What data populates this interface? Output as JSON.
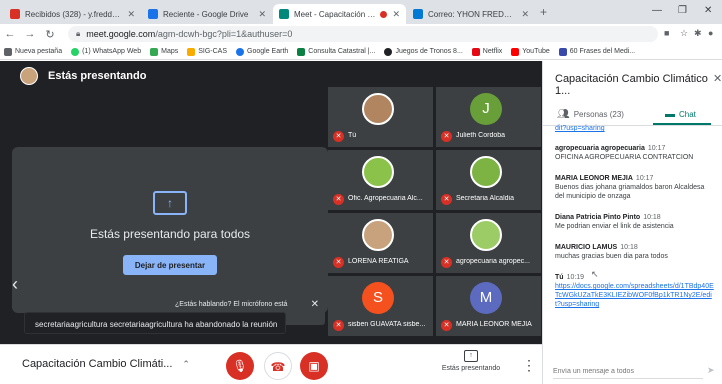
{
  "browser": {
    "tabs": [
      {
        "title": "Recibidos (328) - y.freddymcj@g",
        "color": "#d93025",
        "active": false
      },
      {
        "title": "Reciente - Google Drive",
        "color": "#1a73e8",
        "active": false
      },
      {
        "title": "Meet - Capacitación Cambio",
        "color": "#00897b",
        "active": true
      },
      {
        "title": "Correo: YHON FREDDY MURILLO",
        "color": "#0078d4",
        "active": false
      }
    ],
    "new_tab": "+",
    "address": {
      "host": "meet.google.com",
      "path": "/agm-dcwh-bgc?pli=1&authuser=0"
    },
    "bookmarks": [
      {
        "label": "Nueva pestaña",
        "color": "#5f6368"
      },
      {
        "label": "(1) WhatsApp Web",
        "color": "#25d366"
      },
      {
        "label": "Maps",
        "color": "#34a853"
      },
      {
        "label": "SIG-CAS",
        "color": "#f9ab00"
      },
      {
        "label": "Google Earth",
        "color": "#1a73e8"
      },
      {
        "label": "Consulta Catastral |...",
        "color": "#0b8043"
      },
      {
        "label": "Juegos de Tronos 8...",
        "color": "#202124"
      },
      {
        "label": "Netflix",
        "color": "#e50914"
      },
      {
        "label": "YouTube",
        "color": "#ff0000"
      },
      {
        "label": "60 Frases del Medi...",
        "color": "#3949ab"
      }
    ]
  },
  "meet": {
    "presenting_header": "Estás presentando",
    "card": {
      "message": "Estás presentando para todos",
      "stop_button": "Dejar de presentar"
    },
    "tiles": [
      {
        "name": "Tú",
        "initial": "",
        "color": "#b0855f",
        "pic": true
      },
      {
        "name": "Julieth Cordoba",
        "initial": "J",
        "color": "#689f38",
        "pic": false
      },
      {
        "name": "Ofic. Agropecuaria Alc...",
        "initial": "",
        "color": "#8bc34a",
        "pic": true
      },
      {
        "name": "Secretaria Alcaldia",
        "initial": "",
        "color": "#7cb342",
        "pic": true
      },
      {
        "name": "LORENA REATIGA",
        "initial": "",
        "color": "#c8a27c",
        "pic": true
      },
      {
        "name": "agropecuaria agropec...",
        "initial": "",
        "color": "#9ccc65",
        "pic": true
      },
      {
        "name": "sisben GUAVATA sisbe...",
        "initial": "S",
        "color": "#f4511e",
        "pic": false
      },
      {
        "name": "MARIA LEONOR MEJIA",
        "initial": "M",
        "color": "#5c6bc0",
        "pic": false
      }
    ],
    "talking_notice": "¿Estás hablando? El micrófono está",
    "toast": "secretariaagricultura secretariaagricultura ha abandonado la reunión",
    "bottom": {
      "meeting_name": "Capacitación Cambio Climáti...",
      "presenting_label": "Estás presentando"
    }
  },
  "panel": {
    "title": "Capacitación Cambio Climático 1...",
    "tabs": {
      "people": "Personas (23)",
      "chat": "Chat"
    },
    "top_link_fragment": "dit?usp=sharing",
    "messages": [
      {
        "who": "agropecuaria agropecuaria",
        "when": "10:17",
        "body": "OFICINA AGROPECUARIA CONTRATCION",
        "link": ""
      },
      {
        "who": "MARIA LEONOR MEJIA",
        "when": "10:17",
        "body": "Buenos dias johana griamaldos baron Alcaldesa del municipio de onzaga",
        "link": ""
      },
      {
        "who": "Diana Patricia Pinto Pinto",
        "when": "10:18",
        "body": "Me podrian enviar el link de asistencia",
        "link": ""
      },
      {
        "who": "MAURICIO LAMUS",
        "when": "10:18",
        "body": "muchas gracias buen dia para todos",
        "link": ""
      },
      {
        "who": "Tú",
        "when": "10:19",
        "body": "",
        "link": "https://docs.google.com/spreadsheets/d/1TBdp40ETcWGkUZaTkE3KLIEZibWOF0fBp1kTR1Ny2E/edit?usp=sharing"
      }
    ],
    "input_placeholder": "Envía un mensaje a todos"
  }
}
